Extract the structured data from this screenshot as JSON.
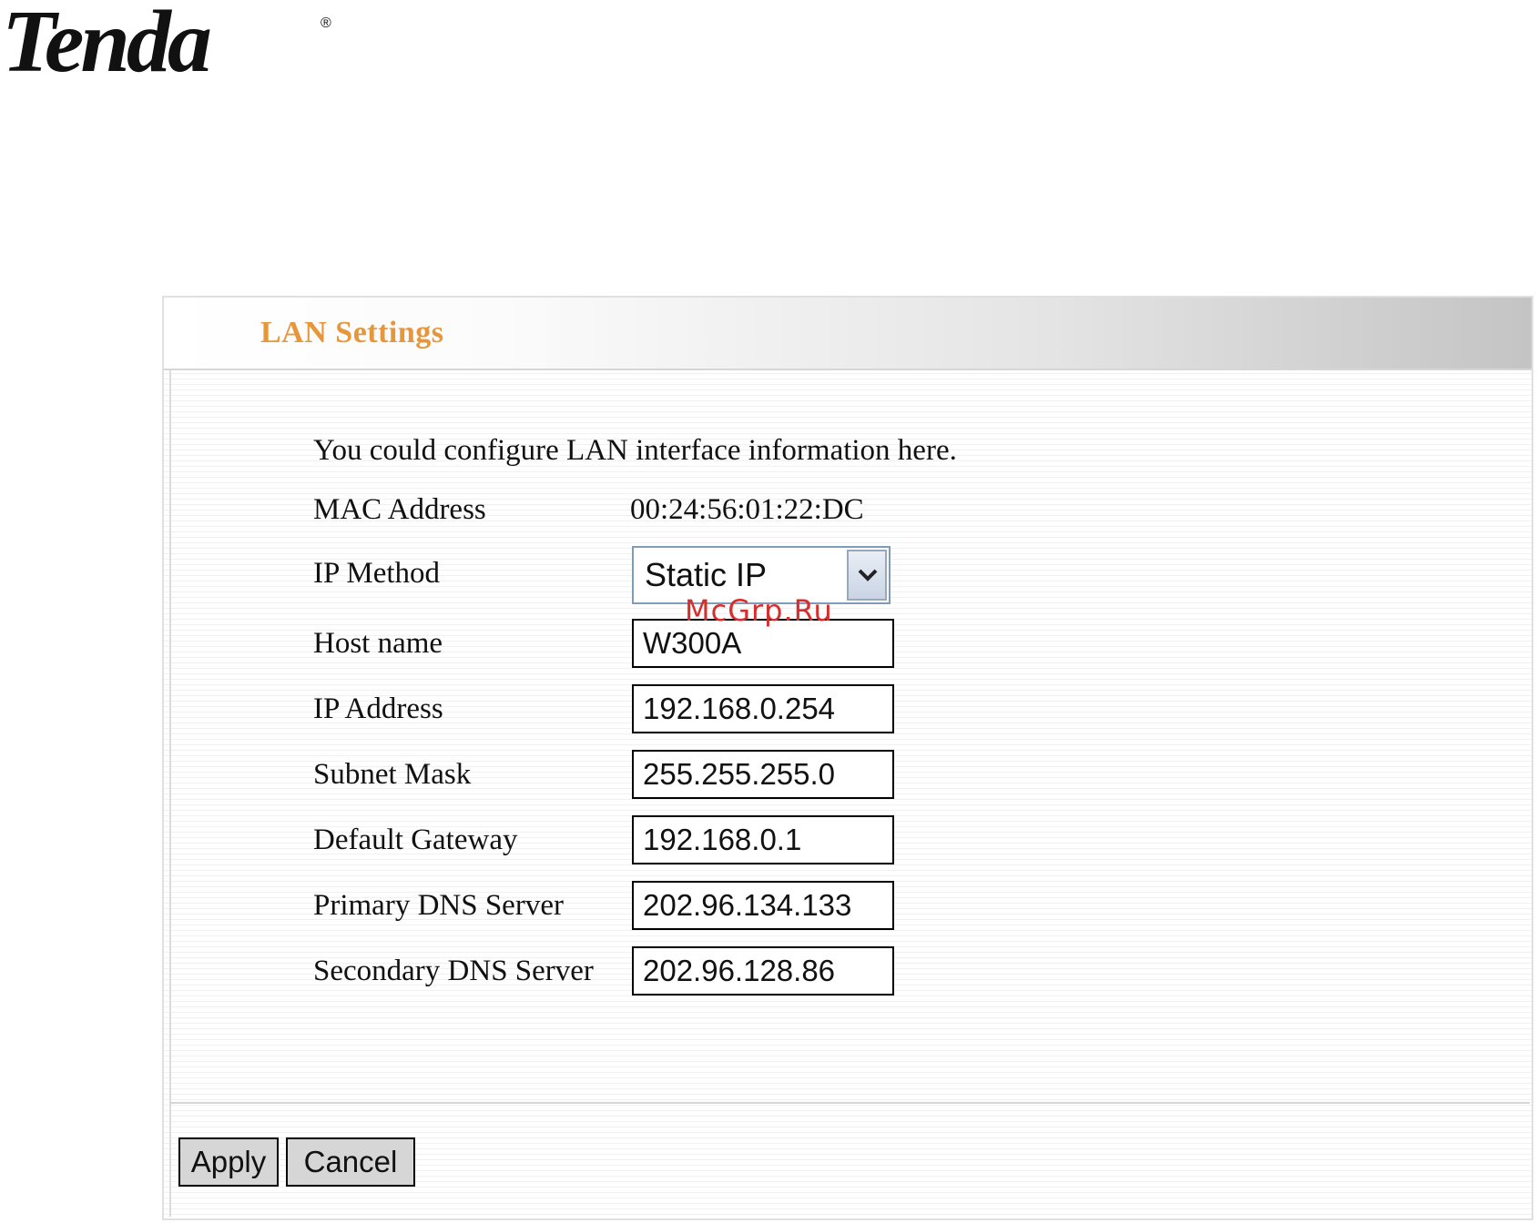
{
  "brand": {
    "logo_text": "Tenda"
  },
  "panel": {
    "title": "LAN Settings",
    "intro": "You could configure LAN interface information here.",
    "mac_address": {
      "label": "MAC Address",
      "value": "00:24:56:01:22:DC"
    },
    "ip_method": {
      "label": "IP Method",
      "value": "Static IP"
    },
    "host_name": {
      "label": "Host name",
      "value": "W300A"
    },
    "ip_address": {
      "label": "IP Address",
      "value": "192.168.0.254"
    },
    "subnet_mask": {
      "label": "Subnet Mask",
      "value": "255.255.255.0"
    },
    "default_gateway": {
      "label": "Default Gateway",
      "value": "192.168.0.1"
    },
    "primary_dns": {
      "label": "Primary DNS Server",
      "value": "202.96.134.133"
    },
    "secondary_dns": {
      "label": "Secondary DNS Server",
      "value": "202.96.128.86"
    }
  },
  "actions": {
    "apply_label": "Apply",
    "cancel_label": "Cancel"
  },
  "watermark": "McGrp.Ru",
  "colors": {
    "title_orange": "#e8963a",
    "watermark_red": "#d92d2d"
  }
}
